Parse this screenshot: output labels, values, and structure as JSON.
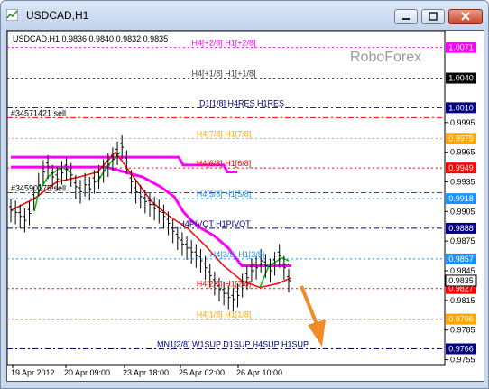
{
  "window": {
    "title": "USDCAD,H1",
    "buttons": {
      "minimize": "minimize",
      "restore": "restore",
      "close": "close"
    }
  },
  "chart": {
    "info": "USDCAD,H1  0.9836 0.9840 0.9832 0.9835",
    "watermark": "RoboForex",
    "colors": {
      "magenta": "#ff00ff",
      "red": "#ff0000",
      "green": "#00c000",
      "orange_arrow": "#f28c28",
      "navy": "#000080",
      "black": "#000000",
      "price_box": "#000000"
    },
    "levels": [
      {
        "label": "H4[+2/8] H1[+2/8]",
        "price": "1.0071",
        "color": "#ff00ff",
        "bg": "#ff00ff",
        "fg": "#ffffff"
      },
      {
        "label": "H4[+1/8] H1[+1/8]",
        "price": "1.0040",
        "color": "#404040",
        "bg": "#000000",
        "fg": "#ffffff"
      },
      {
        "label": "D1[1/8] H4RES H1RES",
        "price": "1.0010",
        "color": "#000080",
        "bg": "#000080",
        "fg": "#ffffff"
      },
      {
        "label": "H4[7/8] H1[7/8]",
        "price": "0.9979",
        "color": "#ffa500",
        "bg": "#ffa500",
        "fg": "#ffffff"
      },
      {
        "label": "H4[6/8] H1[6/8]",
        "price": "0.9949",
        "color": "#ff0000",
        "bg": "#ff0000",
        "fg": "#ffffff"
      },
      {
        "label": "H4[5/8] H1[5/8]",
        "price": "0.9918",
        "color": "#1e90ff",
        "bg": "#1e90ff",
        "fg": "#ffffff"
      },
      {
        "label": "H4PIVOT H1PIVOT",
        "price": "0.9888",
        "color": "#000080",
        "bg": "#000080",
        "fg": "#ffffff"
      },
      {
        "label": "H4[3/8] H1[3/8]",
        "price": "0.9857",
        "color": "#1e90ff",
        "bg": "#1e90ff",
        "fg": "#ffffff"
      },
      {
        "label": "H4[2/8] H1[2/8]",
        "price": "0.9827",
        "color": "#ff0000",
        "bg": "#ff0000",
        "fg": "#ffffff"
      },
      {
        "label": "H4[1/8] H1[1/8]",
        "price": "0.9796",
        "color": "#ffa500",
        "bg": "#ffa500",
        "fg": "#ffffff"
      },
      {
        "label": "MN1[2/8] W1SUP D1SUP H4SUP H1SUP",
        "price": "0.9766",
        "color": "#000080",
        "bg": "#000080",
        "fg": "#ffffff"
      }
    ],
    "current_price": "0.9835",
    "y_ticks": [
      "0.9995",
      "0.9965",
      "0.9935",
      "0.9905",
      "0.9875",
      "0.9845",
      "0.9815",
      "0.9785",
      "0.9755"
    ],
    "x_ticks": [
      "19 Apr 2012",
      "20 Apr 09:00",
      "23 Apr 18:00",
      "25 Apr 02:00",
      "26 Apr 10:00"
    ],
    "orders": [
      {
        "label": "#34571421 sell",
        "price": 1.0
      },
      {
        "label": "#34590175 sell",
        "price": 0.9924
      }
    ],
    "price_range": [
      0.975,
      1.0088
    ]
  }
}
